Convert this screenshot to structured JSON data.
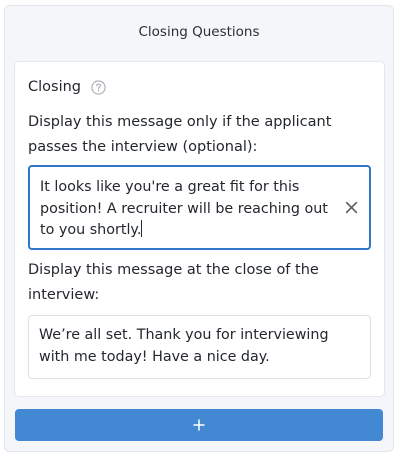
{
  "panel": {
    "title": "Closing Questions"
  },
  "closing_card": {
    "title": "Closing",
    "help_icon": "question-circle-icon",
    "pass_label": "Display this message only if the applicant passes the interview (optional):",
    "pass_message": "It looks like you're a great fit for this position! A recruiter will be reaching out to you shortly.",
    "clear_icon": "close-icon",
    "close_label": "Display this message at the close of the interview:",
    "close_message": "We’re all set. Thank you for interviewing with me today! Have a nice day."
  },
  "add_button": {
    "icon": "plus-icon"
  },
  "colors": {
    "accent": "#4288d3",
    "focus_border": "#2e78c7",
    "panel_bg": "#f4f6fa"
  }
}
